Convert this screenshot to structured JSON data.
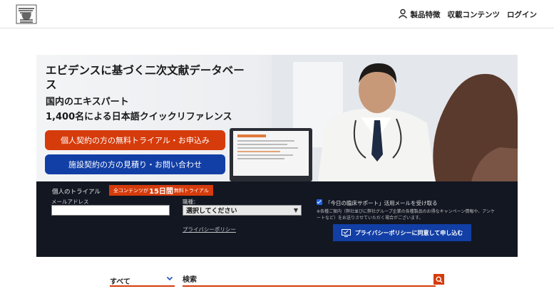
{
  "header": {
    "logo_icon": "bird-logo-icon",
    "nav": [
      {
        "label": "製品特徴"
      },
      {
        "label": "収載コンテンツ"
      },
      {
        "label": "ログイン"
      }
    ]
  },
  "hero": {
    "title": "エビデンスに基づく二次文献データベース",
    "subtitle1": "国内のエキスパート",
    "subtitle2": "1,400名による日本語クイックリファレンス",
    "trial_button": "個人契約の方の無料トライアル・お申込み",
    "quote_button": "施設契約の方の見積り・お問い合わせ"
  },
  "trial_form": {
    "title": "個人のトライアル",
    "badge_prefix": "全コンテンツが",
    "badge_highlight": "15日間",
    "badge_suffix": "無料トライアル",
    "email_label": "メールアドレス",
    "email_value": "",
    "job_label": "職種：",
    "job_selected": "選択してください",
    "privacy_link": "プライバシーポリシー",
    "checkbox_checked": true,
    "checkbox_label": "「今日の臨床サポート」活用メールを受け取る",
    "note": "※各種ご案内（弊社並びに弊社グループ企業の各種製品のお得なキャンペーン情報や、アンケートなど）をお送りさせていただく場合がございます。",
    "submit_label": "プライバシーポリシーに同意して申し込む"
  },
  "search": {
    "category": "すべて",
    "placeholder": "検索"
  },
  "colors": {
    "accent_orange": "#d63b0b",
    "brand_blue": "#123fa6",
    "panel_dark": "#121722"
  }
}
